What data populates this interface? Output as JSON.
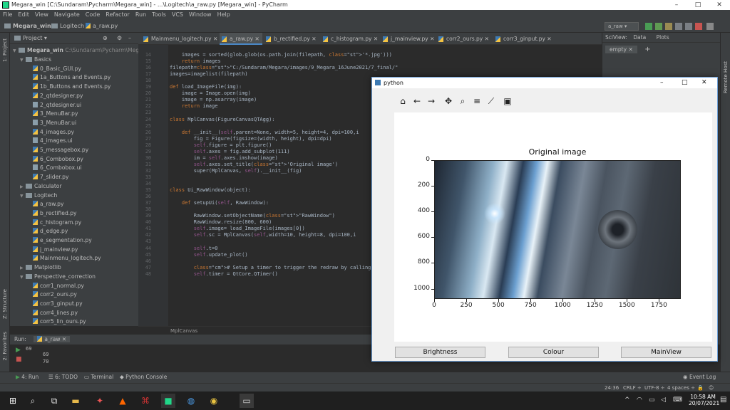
{
  "ide": {
    "title": "Megara_win [C:\\Sundaram\\Pycharm\\Megara_win] - ...\\Logitech\\a_raw.py [Megara_win] - PyCharm",
    "menu": [
      "File",
      "Edit",
      "View",
      "Navigate",
      "Code",
      "Refactor",
      "Run",
      "Tools",
      "VCS",
      "Window",
      "Help"
    ],
    "breadcrumbs": [
      "Megara_win",
      "Logitech",
      "a_raw.py"
    ],
    "run_config": "a_raw"
  },
  "project": {
    "header": "Project",
    "root": "Megara_win",
    "root_path": "C:\\Sundaram\\Pycharm\\Megara",
    "tree": [
      {
        "label": "Basics",
        "type": "dir",
        "depth": 1,
        "open": true
      },
      {
        "label": "0_Basic_GUI.py",
        "type": "py",
        "depth": 2
      },
      {
        "label": "1a_Buttons and Events.py",
        "type": "py",
        "depth": 2
      },
      {
        "label": "1b_Buttons and Events.py",
        "type": "py",
        "depth": 2
      },
      {
        "label": "2_qtdesigner.py",
        "type": "py",
        "depth": 2
      },
      {
        "label": "2_qtdesigner.ui",
        "type": "ui",
        "depth": 2
      },
      {
        "label": "3_MenuBar.py",
        "type": "py",
        "depth": 2
      },
      {
        "label": "3_MenuBar.ui",
        "type": "ui",
        "depth": 2
      },
      {
        "label": "4_images.py",
        "type": "py",
        "depth": 2
      },
      {
        "label": "4_images.ui",
        "type": "ui",
        "depth": 2
      },
      {
        "label": "5_messagebox.py",
        "type": "py",
        "depth": 2
      },
      {
        "label": "6_Combobox.py",
        "type": "py",
        "depth": 2
      },
      {
        "label": "6_Combobox.ui",
        "type": "ui",
        "depth": 2
      },
      {
        "label": "7_slider.py",
        "type": "py",
        "depth": 2
      },
      {
        "label": "Calculator",
        "type": "dir",
        "depth": 1,
        "open": false
      },
      {
        "label": "Logitech",
        "type": "dir",
        "depth": 1,
        "open": true
      },
      {
        "label": "a_raw.py",
        "type": "py",
        "depth": 2
      },
      {
        "label": "b_rectified.py",
        "type": "py",
        "depth": 2
      },
      {
        "label": "c_histogram.py",
        "type": "py",
        "depth": 2
      },
      {
        "label": "d_edge.py",
        "type": "py",
        "depth": 2
      },
      {
        "label": "e_segmentation.py",
        "type": "py",
        "depth": 2
      },
      {
        "label": "j_mainview.py",
        "type": "py",
        "depth": 2
      },
      {
        "label": "Mainmenu_logitech.py",
        "type": "py",
        "depth": 2
      },
      {
        "label": "Matplotlib",
        "type": "dir",
        "depth": 1,
        "open": false
      },
      {
        "label": "Perspective_correction",
        "type": "dir",
        "depth": 1,
        "open": true
      },
      {
        "label": "corr1_normal.py",
        "type": "py",
        "depth": 2
      },
      {
        "label": "corr2_ours.py",
        "type": "py",
        "depth": 2
      },
      {
        "label": "corr3_ginput.py",
        "type": "py",
        "depth": 2
      },
      {
        "label": "corr4_lines.py",
        "type": "py",
        "depth": 2
      },
      {
        "label": "corr5_lin_ours.py",
        "type": "py",
        "depth": 2
      }
    ]
  },
  "tabs": [
    "Mainmenu_logitech.py",
    "a_raw.py",
    "b_rectified.py",
    "c_histogram.py",
    "j_mainview.py",
    "corr2_ours.py",
    "corr3_ginput.py"
  ],
  "code": {
    "lines": [
      {
        "n": "14",
        "t": "    images = sorted(glob.glob(os.path.join(filepath, '*.jpg')))"
      },
      {
        "n": "15",
        "t": "    return images"
      },
      {
        "n": "16",
        "t": "filepath=\"C:/Sundaram/Megara/images/9_Megara_16June2021/7_final/\""
      },
      {
        "n": "17",
        "t": "images=imagelist(filepath)"
      },
      {
        "n": "18",
        "t": ""
      },
      {
        "n": "19",
        "t": "def load_ImageFile(img):"
      },
      {
        "n": "20",
        "t": "    image = Image.open(img)"
      },
      {
        "n": "21",
        "t": "    image = np.asarray(image)"
      },
      {
        "n": "22",
        "t": "    return image"
      },
      {
        "n": "23",
        "t": ""
      },
      {
        "n": "24",
        "t": "class MplCanvas(FigureCanvasQTAgg):"
      },
      {
        "n": "25",
        "t": ""
      },
      {
        "n": "26",
        "t": "    def __init__(self,parent=None, width=5, height=4, dpi=100,i"
      },
      {
        "n": "27",
        "t": "        fig = Figure(figsize=(width, height), dpi=dpi)"
      },
      {
        "n": "28",
        "t": "        self.figure = plt.figure()"
      },
      {
        "n": "29",
        "t": "        self.axes = fig.add_subplot(111)"
      },
      {
        "n": "30",
        "t": "        im = self.axes.imshow(image)"
      },
      {
        "n": "31",
        "t": "        self.axes.set_title('Original image')"
      },
      {
        "n": "32",
        "t": "        super(MplCanvas, self).__init__(fig)"
      },
      {
        "n": "33",
        "t": ""
      },
      {
        "n": "34",
        "t": ""
      },
      {
        "n": "35",
        "t": "class Ui_RawWindow(object):"
      },
      {
        "n": "36",
        "t": ""
      },
      {
        "n": "37",
        "t": "    def setupUi(self, RawWindow):"
      },
      {
        "n": "38",
        "t": ""
      },
      {
        "n": "39",
        "t": "        RawWindow.setObjectName(\"RawWindow\")"
      },
      {
        "n": "40",
        "t": "        RawWindow.resize(800, 600)"
      },
      {
        "n": "41",
        "t": "        self.image= load_ImageFile(images[0])"
      },
      {
        "n": "42",
        "t": "        self.sc = MplCanvas(self,width=10, height=8, dpi=100,i"
      },
      {
        "n": "43",
        "t": ""
      },
      {
        "n": "44",
        "t": "        self.t=0"
      },
      {
        "n": "45",
        "t": "        self.update_plot()"
      },
      {
        "n": "46",
        "t": ""
      },
      {
        "n": "47",
        "t": "        # Setup a timer to trigger the redraw by calling update"
      },
      {
        "n": "48",
        "t": "        self.timer = QtCore.QTimer()"
      }
    ],
    "footer": "MplCanvas"
  },
  "sciview": {
    "title": "SciView:",
    "tabs": [
      "Data",
      "Plots"
    ],
    "empty_tab": "empty"
  },
  "run": {
    "label": "Run:",
    "config": "a_raw",
    "output": [
      "69",
      "70"
    ]
  },
  "bottom_tools": [
    "4: Run",
    "6: TODO",
    "Terminal",
    "Python Console"
  ],
  "event_log": "Event Log",
  "status": {
    "pos": "24:36",
    "crlf": "CRLF",
    "enc": "UTF-8",
    "indent": "4 spaces"
  },
  "taskbar": {
    "time": "10:58 AM",
    "date": "20/07/2021"
  },
  "mpl": {
    "title": "python",
    "chart_title": "Original image",
    "x_ticks": [
      "0",
      "250",
      "500",
      "750",
      "1000",
      "1250",
      "1500",
      "1750"
    ],
    "y_ticks": [
      "0",
      "200",
      "400",
      "600",
      "800",
      "1000"
    ],
    "buttons": [
      "Brightness",
      "Colour",
      "MainView"
    ]
  },
  "chart_data": {
    "type": "image",
    "title": "Original image",
    "x_ticks": [
      0,
      250,
      500,
      750,
      1000,
      1250,
      1500,
      1750
    ],
    "y_ticks": [
      0,
      200,
      400,
      600,
      800,
      1000
    ],
    "xlim": [
      0,
      1920
    ],
    "ylim": [
      1080,
      0
    ]
  }
}
